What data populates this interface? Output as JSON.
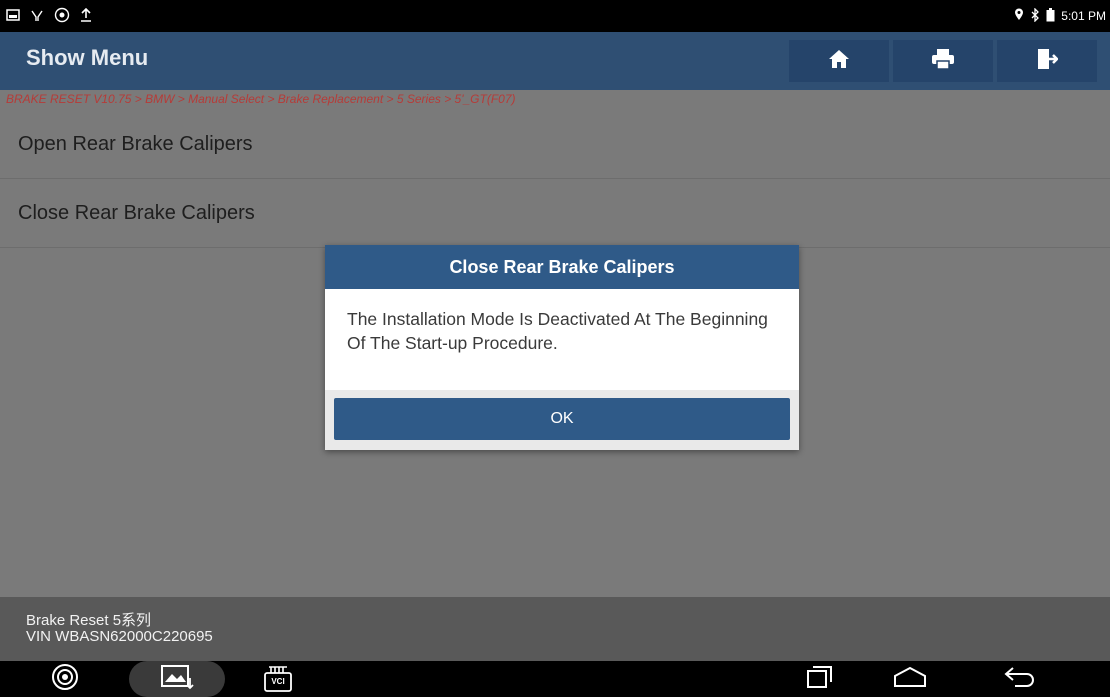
{
  "status_bar": {
    "time": "5:01 PM",
    "left_icons": [
      "notification-image-icon",
      "usb-debug-icon",
      "settings-badge-icon",
      "upload-icon"
    ],
    "right_icons": [
      "location-icon",
      "bluetooth-icon",
      "battery-icon"
    ]
  },
  "header": {
    "title": "Show Menu",
    "buttons": [
      "home-icon",
      "print-icon",
      "exit-icon"
    ]
  },
  "breadcrumb": "BRAKE RESET V10.75 > BMW > Manual Select > Brake Replacement > 5 Series > 5'_GT(F07)",
  "menu": {
    "items": [
      {
        "label": "Open Rear Brake Calipers"
      },
      {
        "label": "Close Rear Brake Calipers"
      }
    ]
  },
  "dialog": {
    "title": "Close Rear Brake Calipers",
    "message": "The Installation Mode Is Deactivated At The Beginning Of The Start-up Procedure.",
    "ok_label": "OK"
  },
  "footer": {
    "line1": "Brake Reset 5系列",
    "line2": "VIN WBASN62000C220695"
  },
  "nav_bar": {
    "vci_label": "VCI"
  },
  "colors": {
    "header": "#2f4f73",
    "dialog_accent": "#2f5a88",
    "breadcrumb": "#b63b38",
    "background": "#7a7a7a"
  }
}
